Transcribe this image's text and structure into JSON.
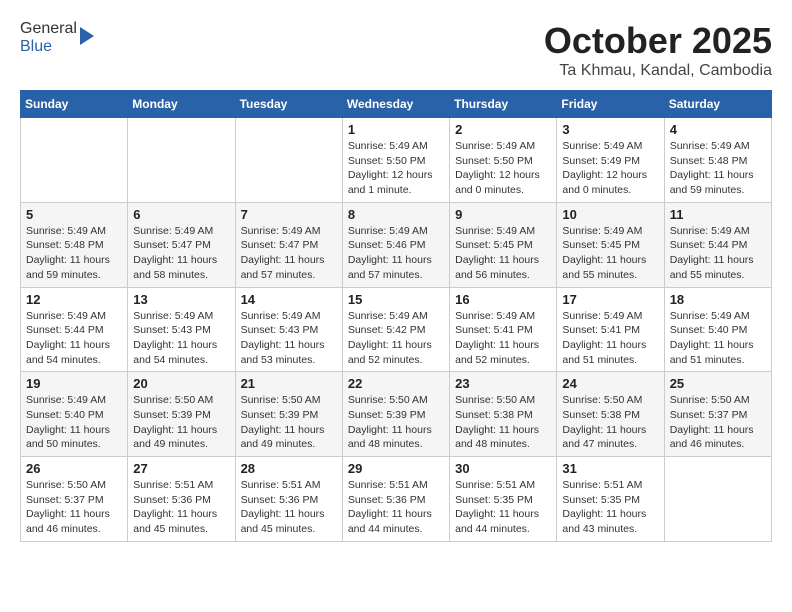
{
  "header": {
    "logo_general": "General",
    "logo_blue": "Blue",
    "month": "October 2025",
    "location": "Ta Khmau, Kandal, Cambodia"
  },
  "days_of_week": [
    "Sunday",
    "Monday",
    "Tuesday",
    "Wednesday",
    "Thursday",
    "Friday",
    "Saturday"
  ],
  "weeks": [
    [
      {
        "day": "",
        "info": ""
      },
      {
        "day": "",
        "info": ""
      },
      {
        "day": "",
        "info": ""
      },
      {
        "day": "1",
        "info": "Sunrise: 5:49 AM\nSunset: 5:50 PM\nDaylight: 12 hours\nand 1 minute."
      },
      {
        "day": "2",
        "info": "Sunrise: 5:49 AM\nSunset: 5:50 PM\nDaylight: 12 hours\nand 0 minutes."
      },
      {
        "day": "3",
        "info": "Sunrise: 5:49 AM\nSunset: 5:49 PM\nDaylight: 12 hours\nand 0 minutes."
      },
      {
        "day": "4",
        "info": "Sunrise: 5:49 AM\nSunset: 5:48 PM\nDaylight: 11 hours\nand 59 minutes."
      }
    ],
    [
      {
        "day": "5",
        "info": "Sunrise: 5:49 AM\nSunset: 5:48 PM\nDaylight: 11 hours\nand 59 minutes."
      },
      {
        "day": "6",
        "info": "Sunrise: 5:49 AM\nSunset: 5:47 PM\nDaylight: 11 hours\nand 58 minutes."
      },
      {
        "day": "7",
        "info": "Sunrise: 5:49 AM\nSunset: 5:47 PM\nDaylight: 11 hours\nand 57 minutes."
      },
      {
        "day": "8",
        "info": "Sunrise: 5:49 AM\nSunset: 5:46 PM\nDaylight: 11 hours\nand 57 minutes."
      },
      {
        "day": "9",
        "info": "Sunrise: 5:49 AM\nSunset: 5:45 PM\nDaylight: 11 hours\nand 56 minutes."
      },
      {
        "day": "10",
        "info": "Sunrise: 5:49 AM\nSunset: 5:45 PM\nDaylight: 11 hours\nand 55 minutes."
      },
      {
        "day": "11",
        "info": "Sunrise: 5:49 AM\nSunset: 5:44 PM\nDaylight: 11 hours\nand 55 minutes."
      }
    ],
    [
      {
        "day": "12",
        "info": "Sunrise: 5:49 AM\nSunset: 5:44 PM\nDaylight: 11 hours\nand 54 minutes."
      },
      {
        "day": "13",
        "info": "Sunrise: 5:49 AM\nSunset: 5:43 PM\nDaylight: 11 hours\nand 54 minutes."
      },
      {
        "day": "14",
        "info": "Sunrise: 5:49 AM\nSunset: 5:43 PM\nDaylight: 11 hours\nand 53 minutes."
      },
      {
        "day": "15",
        "info": "Sunrise: 5:49 AM\nSunset: 5:42 PM\nDaylight: 11 hours\nand 52 minutes."
      },
      {
        "day": "16",
        "info": "Sunrise: 5:49 AM\nSunset: 5:41 PM\nDaylight: 11 hours\nand 52 minutes."
      },
      {
        "day": "17",
        "info": "Sunrise: 5:49 AM\nSunset: 5:41 PM\nDaylight: 11 hours\nand 51 minutes."
      },
      {
        "day": "18",
        "info": "Sunrise: 5:49 AM\nSunset: 5:40 PM\nDaylight: 11 hours\nand 51 minutes."
      }
    ],
    [
      {
        "day": "19",
        "info": "Sunrise: 5:49 AM\nSunset: 5:40 PM\nDaylight: 11 hours\nand 50 minutes."
      },
      {
        "day": "20",
        "info": "Sunrise: 5:50 AM\nSunset: 5:39 PM\nDaylight: 11 hours\nand 49 minutes."
      },
      {
        "day": "21",
        "info": "Sunrise: 5:50 AM\nSunset: 5:39 PM\nDaylight: 11 hours\nand 49 minutes."
      },
      {
        "day": "22",
        "info": "Sunrise: 5:50 AM\nSunset: 5:39 PM\nDaylight: 11 hours\nand 48 minutes."
      },
      {
        "day": "23",
        "info": "Sunrise: 5:50 AM\nSunset: 5:38 PM\nDaylight: 11 hours\nand 48 minutes."
      },
      {
        "day": "24",
        "info": "Sunrise: 5:50 AM\nSunset: 5:38 PM\nDaylight: 11 hours\nand 47 minutes."
      },
      {
        "day": "25",
        "info": "Sunrise: 5:50 AM\nSunset: 5:37 PM\nDaylight: 11 hours\nand 46 minutes."
      }
    ],
    [
      {
        "day": "26",
        "info": "Sunrise: 5:50 AM\nSunset: 5:37 PM\nDaylight: 11 hours\nand 46 minutes."
      },
      {
        "day": "27",
        "info": "Sunrise: 5:51 AM\nSunset: 5:36 PM\nDaylight: 11 hours\nand 45 minutes."
      },
      {
        "day": "28",
        "info": "Sunrise: 5:51 AM\nSunset: 5:36 PM\nDaylight: 11 hours\nand 45 minutes."
      },
      {
        "day": "29",
        "info": "Sunrise: 5:51 AM\nSunset: 5:36 PM\nDaylight: 11 hours\nand 44 minutes."
      },
      {
        "day": "30",
        "info": "Sunrise: 5:51 AM\nSunset: 5:35 PM\nDaylight: 11 hours\nand 44 minutes."
      },
      {
        "day": "31",
        "info": "Sunrise: 5:51 AM\nSunset: 5:35 PM\nDaylight: 11 hours\nand 43 minutes."
      },
      {
        "day": "",
        "info": ""
      }
    ]
  ]
}
